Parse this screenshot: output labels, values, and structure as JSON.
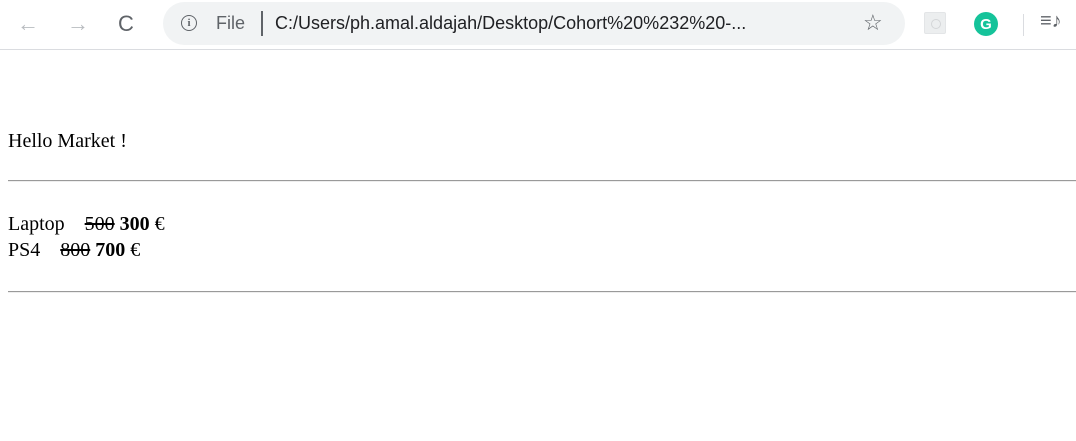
{
  "browser": {
    "back_icon": "←",
    "forward_icon": "→",
    "reload_icon": "C",
    "scheme_label": "File",
    "url": "C:/Users/ph.amal.aldajah/Desktop/Cohort%20%232%20-...",
    "bookmark_icon": "☆",
    "grammarly_label": "G",
    "media_icon": "≡♪"
  },
  "page": {
    "greeting": "Hello Market !",
    "products": [
      {
        "name": "Laptop",
        "old_price": "500",
        "new_price": "300",
        "currency": "€"
      },
      {
        "name": "PS4",
        "old_price": "800",
        "new_price": "700",
        "currency": "€"
      }
    ]
  }
}
